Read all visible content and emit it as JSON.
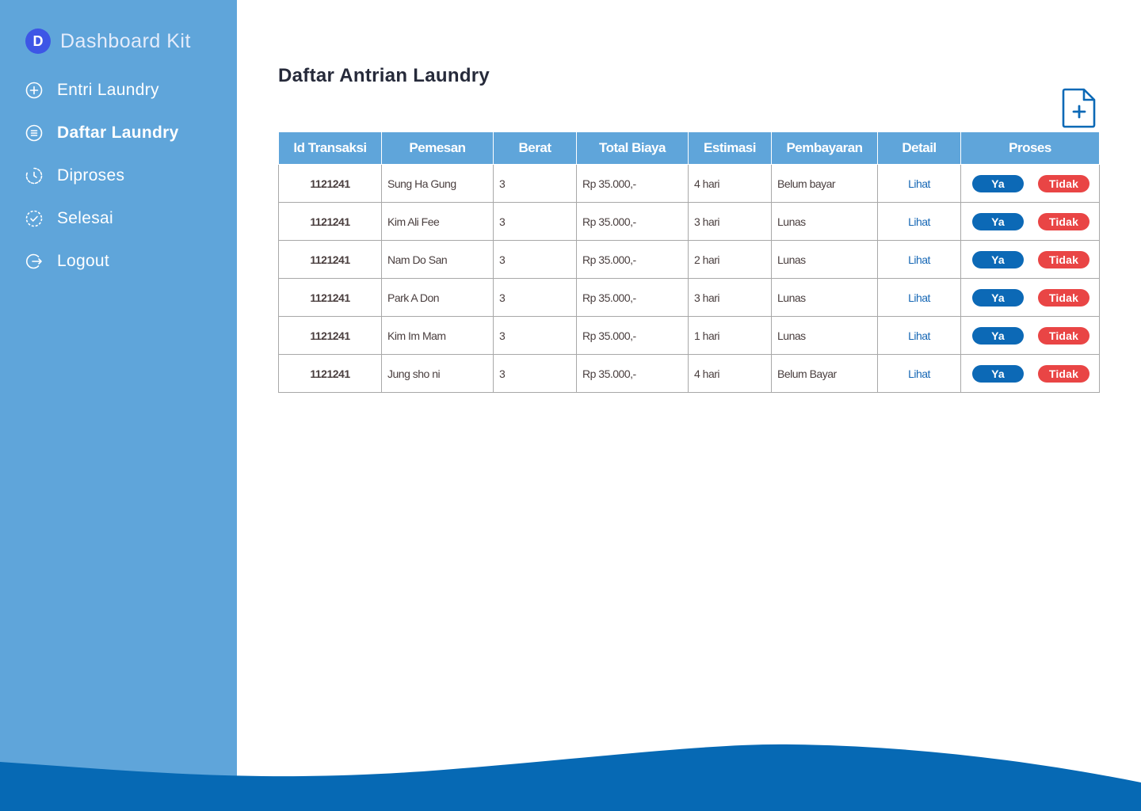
{
  "brand": {
    "logo_letter": "D",
    "name": "Dashboard Kit"
  },
  "sidebar": {
    "items": [
      {
        "label": "Entri Laundry",
        "icon": "plus-circle-icon"
      },
      {
        "label": "Daftar Laundry",
        "icon": "list-circle-icon",
        "active": true
      },
      {
        "label": "Diproses",
        "icon": "clock-icon"
      },
      {
        "label": "Selesai",
        "icon": "check-circle-icon"
      },
      {
        "label": "Logout",
        "icon": "logout-icon"
      }
    ]
  },
  "main": {
    "title": "Daftar Antrian Laundry",
    "add_icon": "add-document-icon",
    "table": {
      "headers": [
        "Id Transaksi",
        "Pemesan",
        "Berat",
        "Total Biaya",
        "Estimasi",
        "Pembayaran",
        "Detail",
        "Proses"
      ],
      "rows": [
        {
          "id": "1121241",
          "pemesan": "Sung Ha Gung",
          "berat": "3",
          "total": "Rp 35.000,-",
          "estimasi": "4 hari",
          "pembayaran": "Belum bayar",
          "detail": "Lihat",
          "ya": "Ya",
          "tidak": "Tidak"
        },
        {
          "id": "1121241",
          "pemesan": "Kim Ali Fee",
          "berat": "3",
          "total": "Rp 35.000,-",
          "estimasi": "3 hari",
          "pembayaran": "Lunas",
          "detail": "Lihat",
          "ya": "Ya",
          "tidak": "Tidak"
        },
        {
          "id": "1121241",
          "pemesan": "Nam Do San",
          "berat": "3",
          "total": "Rp 35.000,-",
          "estimasi": "2 hari",
          "pembayaran": "Lunas",
          "detail": "Lihat",
          "ya": "Ya",
          "tidak": "Tidak"
        },
        {
          "id": "1121241",
          "pemesan": "Park A Don",
          "berat": "3",
          "total": "Rp 35.000,-",
          "estimasi": "3 hari",
          "pembayaran": "Lunas",
          "detail": "Lihat",
          "ya": "Ya",
          "tidak": "Tidak"
        },
        {
          "id": "1121241",
          "pemesan": "Kim Im Mam",
          "berat": "3",
          "total": "Rp 35.000,-",
          "estimasi": "1 hari",
          "pembayaran": "Lunas",
          "detail": "Lihat",
          "ya": "Ya",
          "tidak": "Tidak"
        },
        {
          "id": "1121241",
          "pemesan": "Jung sho ni",
          "berat": "3",
          "total": "Rp 35.000,-",
          "estimasi": "4 hari",
          "pembayaran": "Belum Bayar",
          "detail": "Lihat",
          "ya": "Ya",
          "tidak": "Tidak"
        }
      ]
    }
  },
  "colors": {
    "sidebar_bg": "#5fa5da",
    "accent_dark": "#0c69b6",
    "danger": "#e94545",
    "brand_logo": "#3d56e6"
  }
}
